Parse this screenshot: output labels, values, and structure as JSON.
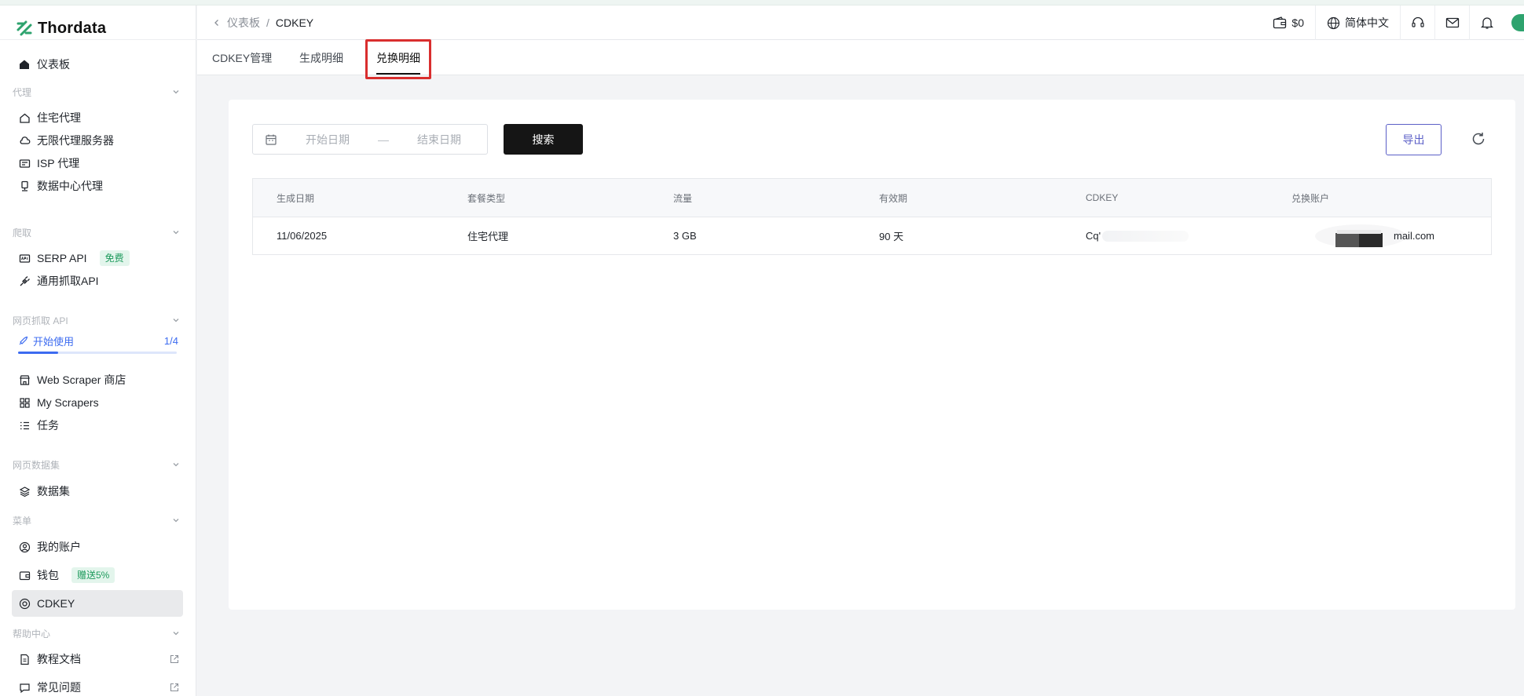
{
  "brand": {
    "name": "Thordata",
    "accent": "#2ea36e"
  },
  "sidebar": {
    "dashboard": "仪表板",
    "sections": {
      "proxy": "代理",
      "scrape": "爬取",
      "web_scrape_api": "网页抓取 API",
      "datasets": "网页数据集",
      "menu": "菜单",
      "help": "帮助中心"
    },
    "proxy_items": [
      "住宅代理",
      "无限代理服务器",
      "ISP 代理",
      "数据中心代理"
    ],
    "scrape_items": {
      "serp": "SERP API",
      "serp_badge": "免费",
      "universal": "通用抓取API"
    },
    "getting_started": {
      "label": "开始使用",
      "progress_text": "1/4",
      "progress": 0.25
    },
    "scraper_items": [
      "Web Scraper 商店",
      "My Scrapers",
      "任务"
    ],
    "dataset_item": "数据集",
    "menu_items": {
      "account": "我的账户",
      "wallet": "钱包",
      "wallet_badge": "赠送5%",
      "cdkey": "CDKEY"
    },
    "help_items": [
      "教程文档",
      "常见问题"
    ]
  },
  "header": {
    "breadcrumb_parent": "仪表板",
    "breadcrumb_sep": "/",
    "breadcrumb_current": "CDKEY",
    "balance": "$0",
    "language": "简体中文"
  },
  "tabs": [
    "CDKEY管理",
    "生成明细",
    "兑换明细"
  ],
  "active_tab": "兑换明细",
  "filters": {
    "start_placeholder": "开始日期",
    "separator": "—",
    "end_placeholder": "结束日期",
    "search_label": "搜索",
    "export_label": "导出"
  },
  "table": {
    "columns": [
      "生成日期",
      "套餐类型",
      "流量",
      "有效期",
      "CDKEY",
      "兑换账户"
    ],
    "rows": [
      {
        "date": "11/06/2025",
        "plan": "住宅代理",
        "traffic": "3 GB",
        "validity": "90 天",
        "cdkey": "Cq'",
        "account": "mail.com"
      }
    ]
  }
}
